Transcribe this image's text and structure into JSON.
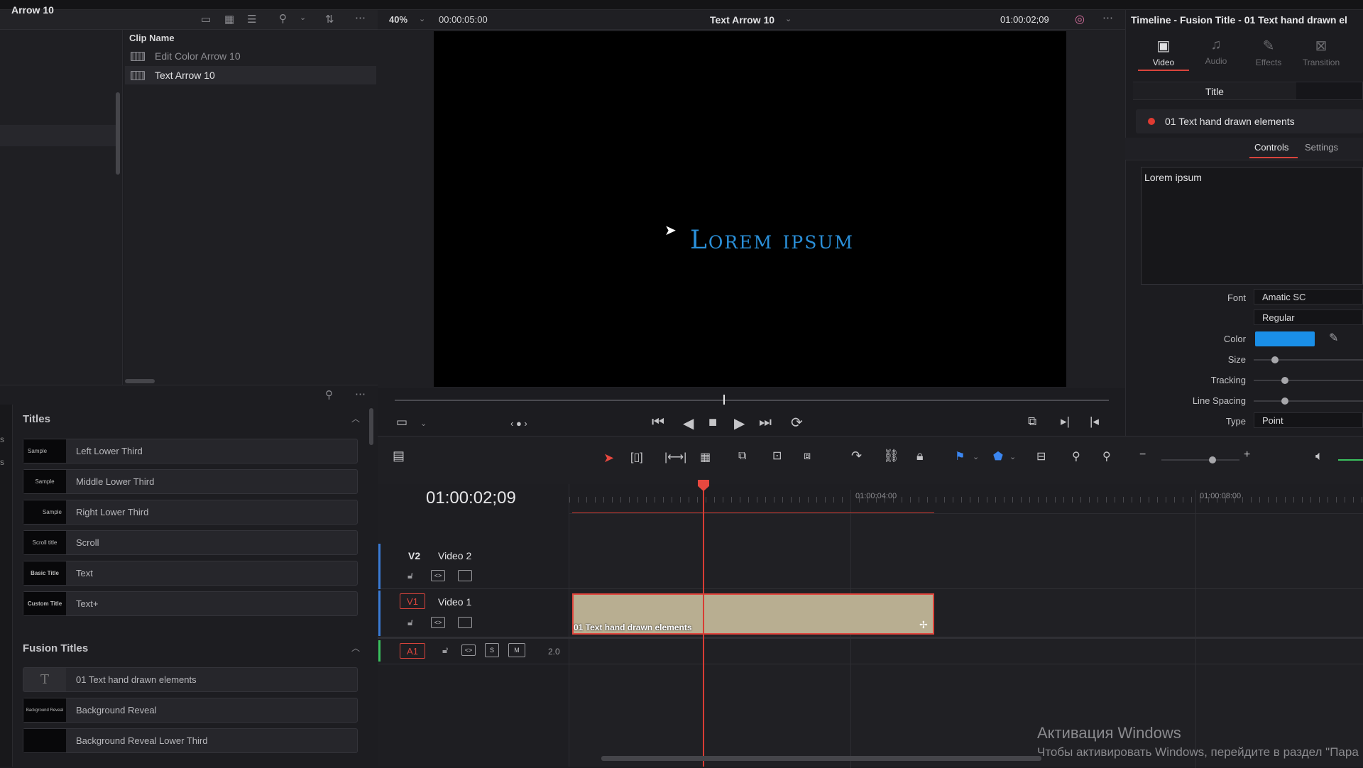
{
  "media_pool": {
    "title": "Arrow 10",
    "column_header": "Clip Name",
    "clips": [
      "Edit Color Arrow 10",
      "Text Arrow 10"
    ]
  },
  "effects": {
    "titles_section": "Titles",
    "titles": [
      {
        "label": "Left Lower Third",
        "thumb": "Sample"
      },
      {
        "label": "Middle Lower Third",
        "thumb": "Sample"
      },
      {
        "label": "Right Lower Third",
        "thumb": "Sample"
      },
      {
        "label": "Scroll",
        "thumb": "Scroll title"
      },
      {
        "label": "Text",
        "thumb": "Basic Title"
      },
      {
        "label": "Text+",
        "thumb": "Custom Title"
      }
    ],
    "fusion_section": "Fusion Titles",
    "fusion_titles": [
      {
        "label": "01 Text hand drawn elements",
        "thumb": "T"
      },
      {
        "label": "Background Reveal",
        "thumb": "Background Reveal"
      },
      {
        "label": "Background Reveal Lower Third",
        "thumb": ""
      }
    ]
  },
  "viewer": {
    "zoom": "40%",
    "duration": "00:00:05:00",
    "clip_title": "Text Arrow 10",
    "timecode": "01:00:02;09",
    "canvas_text": "Lorem ipsum"
  },
  "inspector": {
    "title": "Timeline - Fusion Title - 01 Text hand drawn el",
    "tabs": [
      "Video",
      "Audio",
      "Effects",
      "Transition"
    ],
    "subtab": "Title",
    "effect_name": "01 Text hand drawn elements",
    "controls_tab": "Controls",
    "settings_tab": "Settings",
    "text_value": "Lorem ipsum",
    "font_label": "Font",
    "font_value": "Amatic SC",
    "style_value": "Regular",
    "color_label": "Color",
    "color_value": "#1a8fe8",
    "size_label": "Size",
    "tracking_label": "Tracking",
    "line_spacing_label": "Line Spacing",
    "type_label": "Type",
    "type_value": "Point"
  },
  "timeline": {
    "timecode": "01:00:02;09",
    "ruler_marks": [
      "01:00:04:00",
      "01:00:08:00"
    ],
    "tracks": [
      {
        "id": "V2",
        "name": "Video 2"
      },
      {
        "id": "V1",
        "name": "Video 1"
      },
      {
        "id": "A1",
        "name": "",
        "level": "2.0"
      }
    ],
    "clip_name": "01 Text hand drawn elements"
  },
  "watermark": {
    "line1": "Активация Windows",
    "line2": "Чтобы активировать Windows, перейдите в раздел \"Пара"
  }
}
